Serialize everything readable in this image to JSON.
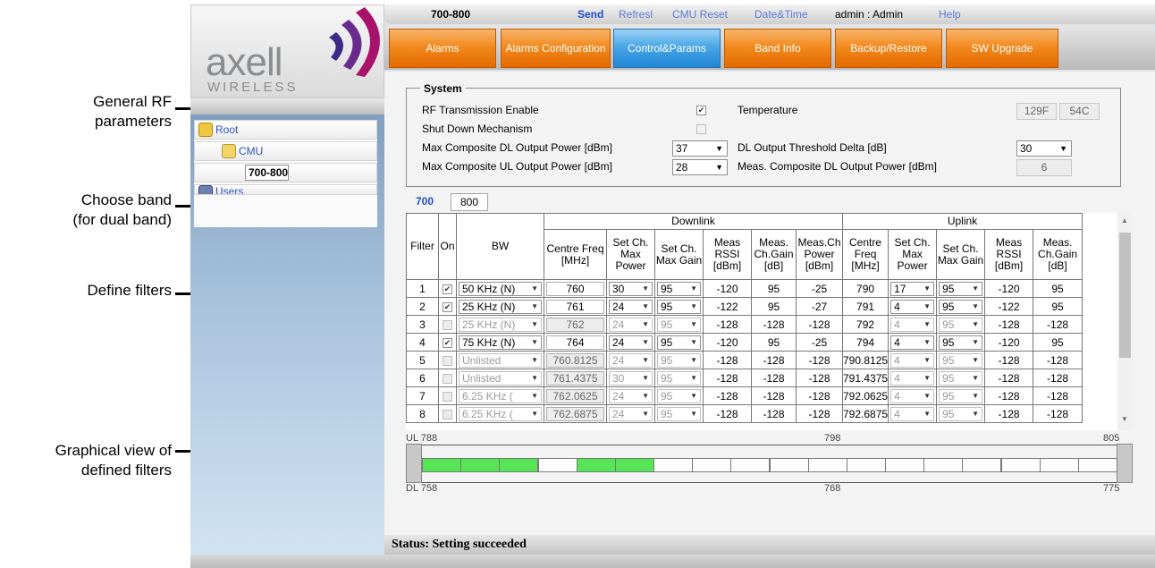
{
  "callouts": {
    "general_rf": [
      "General RF",
      "parameters"
    ],
    "choose_band": [
      "Choose band",
      "(for dual band)"
    ],
    "define_filters": "Define filters",
    "graphical_view": [
      "Graphical view of",
      "defined filters"
    ]
  },
  "logo": {
    "text": "axell",
    "sub": "WIRELESS"
  },
  "nav": {
    "tree": [
      {
        "label": "Root"
      },
      {
        "label": "CMU"
      },
      {
        "label": "700-800"
      },
      {
        "label": "Users"
      }
    ]
  },
  "topbar": {
    "band": "700-800",
    "send": "Send",
    "refresh": "Refresl",
    "cmu_reset": "CMU Reset",
    "datetime": "Date&Time",
    "user": "admin : Admin",
    "help": "Help"
  },
  "tabs": [
    {
      "label": "Alarms"
    },
    {
      "label": "Alarms Configuration"
    },
    {
      "label": "Control&Params"
    },
    {
      "label": "Band Info"
    },
    {
      "label": "Backup/Restore"
    },
    {
      "label": "SW Upgrade"
    }
  ],
  "system": {
    "legend": "System",
    "rf_enable_label": "RF Transmission Enable",
    "rf_enable_checked": true,
    "shutdown_label": "Shut Down Mechanism",
    "shutdown_checked": false,
    "max_dl_label": "Max Composite DL Output Power [dBm]",
    "max_dl_value": "37",
    "max_ul_label": "Max Composite UL Output Power [dBm]",
    "max_ul_value": "28",
    "temp_label": "Temperature",
    "temp_f": "129F",
    "temp_c": "54C",
    "dl_delta_label": "DL Output Threshold Delta [dB]",
    "dl_delta_value": "30",
    "meas_dl_label": "Meas. Composite DL Output Power [dBm]",
    "meas_dl_value": "6"
  },
  "bands": [
    "700",
    "800"
  ],
  "table": {
    "group_downlink": "Downlink",
    "group_uplink": "Uplink",
    "headers": [
      "Filter",
      "On",
      "BW",
      "Centre Freq [MHz]",
      "Set Ch. Max Power",
      "Set Ch. Max Gain",
      "Meas RSSI [dBm]",
      "Meas. Ch.Gain [dB]",
      "Meas.Ch Power [dBm]",
      "Centre Freq [MHz]",
      "Set Ch. Max Power",
      "Set Ch. Max Gain",
      "Meas RSSI [dBm]",
      "Meas. Ch.Gain [dB]"
    ],
    "rows": [
      {
        "filter": "1",
        "on": true,
        "bw": "50 KHz (N)",
        "dl_freq": "760",
        "dl_pwr": "30",
        "dl_gain": "95",
        "dl_rssi": "-120",
        "dl_chgain": "95",
        "dl_chpwr": "-25",
        "ul_freq": "790",
        "ul_pwr": "17",
        "ul_gain": "95",
        "ul_rssi": "-120",
        "ul_chgain": "95"
      },
      {
        "filter": "2",
        "on": true,
        "bw": "25 KHz (N)",
        "dl_freq": "761",
        "dl_pwr": "24",
        "dl_gain": "95",
        "dl_rssi": "-122",
        "dl_chgain": "95",
        "dl_chpwr": "-27",
        "ul_freq": "791",
        "ul_pwr": "4",
        "ul_gain": "95",
        "ul_rssi": "-122",
        "ul_chgain": "95"
      },
      {
        "filter": "3",
        "on": false,
        "bw": "25 KHz (N)",
        "dl_freq": "762",
        "dl_pwr": "24",
        "dl_gain": "95",
        "dl_rssi": "-128",
        "dl_chgain": "-128",
        "dl_chpwr": "-128",
        "ul_freq": "792",
        "ul_pwr": "4",
        "ul_gain": "95",
        "ul_rssi": "-128",
        "ul_chgain": "-128"
      },
      {
        "filter": "4",
        "on": true,
        "bw": "75 KHz (N)",
        "dl_freq": "764",
        "dl_pwr": "24",
        "dl_gain": "95",
        "dl_rssi": "-120",
        "dl_chgain": "95",
        "dl_chpwr": "-25",
        "ul_freq": "794",
        "ul_pwr": "4",
        "ul_gain": "95",
        "ul_rssi": "-120",
        "ul_chgain": "95"
      },
      {
        "filter": "5",
        "on": false,
        "bw": "Unlisted",
        "dl_freq": "760.8125",
        "dl_pwr": "24",
        "dl_gain": "95",
        "dl_rssi": "-128",
        "dl_chgain": "-128",
        "dl_chpwr": "-128",
        "ul_freq": "790.8125",
        "ul_pwr": "4",
        "ul_gain": "95",
        "ul_rssi": "-128",
        "ul_chgain": "-128"
      },
      {
        "filter": "6",
        "on": false,
        "bw": "Unlisted",
        "dl_freq": "761.4375",
        "dl_pwr": "30",
        "dl_gain": "95",
        "dl_rssi": "-128",
        "dl_chgain": "-128",
        "dl_chpwr": "-128",
        "ul_freq": "791.4375",
        "ul_pwr": "4",
        "ul_gain": "95",
        "ul_rssi": "-128",
        "ul_chgain": "-128"
      },
      {
        "filter": "7",
        "on": false,
        "bw": "6.25 KHz (",
        "dl_freq": "762.0625",
        "dl_pwr": "24",
        "dl_gain": "95",
        "dl_rssi": "-128",
        "dl_chgain": "-128",
        "dl_chpwr": "-128",
        "ul_freq": "792.0625",
        "ul_pwr": "4",
        "ul_gain": "95",
        "ul_rssi": "-128",
        "ul_chgain": "-128"
      },
      {
        "filter": "8",
        "on": false,
        "bw": "6.25 KHz (",
        "dl_freq": "762.6875",
        "dl_pwr": "24",
        "dl_gain": "95",
        "dl_rssi": "-128",
        "dl_chgain": "-128",
        "dl_chpwr": "-128",
        "ul_freq": "792.6875",
        "ul_pwr": "4",
        "ul_gain": "95",
        "ul_rssi": "-128",
        "ul_chgain": "-128"
      }
    ]
  },
  "graph": {
    "ul_start": "UL 788",
    "ul_mid": "798",
    "ul_end": "805",
    "dl_start": "DL 758",
    "dl_mid": "768",
    "dl_end": "775",
    "cells_on": [
      true,
      true,
      true,
      false,
      true,
      true,
      false,
      false,
      false,
      false,
      false,
      false,
      false,
      false,
      false,
      false,
      false,
      false
    ],
    "on_color": "#55e555"
  },
  "status": "Status: Setting succeeded"
}
